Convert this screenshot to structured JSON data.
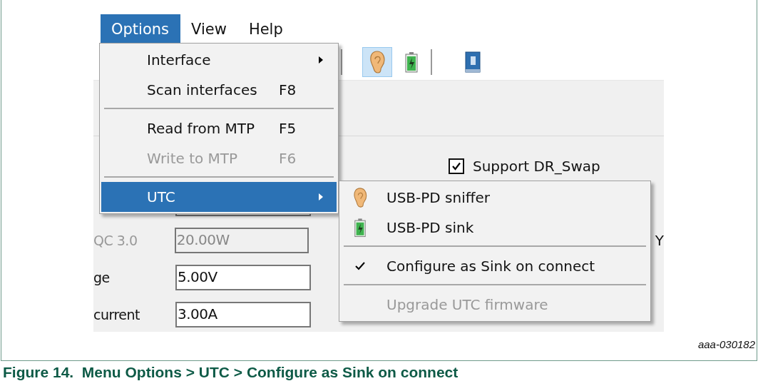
{
  "menu_bar": [
    {
      "label": "Options",
      "selected": true
    },
    {
      "label": "View",
      "selected": false
    },
    {
      "label": "Help",
      "selected": false
    }
  ],
  "toolbar": [
    {
      "kind": "separator"
    },
    {
      "kind": "sniffer",
      "selected": true
    },
    {
      "kind": "sink",
      "selected": false
    },
    {
      "kind": "separator"
    },
    {
      "kind": "help",
      "selected": false
    }
  ],
  "form": {
    "checkbox": {
      "label": "Support DR_Swap",
      "checked": true
    },
    "rows": [
      {
        "label": "",
        "value": ""
      },
      {
        "label": "QC 3.0",
        "value": "20.00W",
        "disabled": true
      },
      {
        "label": "ge",
        "value": "5.00V",
        "disabled": false
      },
      {
        "label": "current",
        "value": "3.00A",
        "disabled": false
      }
    ],
    "side_text": "Y"
  },
  "options_menu": [
    {
      "kind": "item",
      "label": "Interface",
      "submenu": true,
      "disabled": false,
      "selected": false
    },
    {
      "kind": "item",
      "label": "Scan interfaces",
      "shortcut": "F8",
      "submenu": false,
      "disabled": false,
      "selected": false
    },
    {
      "kind": "separator"
    },
    {
      "kind": "item",
      "label": "Read from MTP",
      "shortcut": "F5",
      "submenu": false,
      "disabled": false,
      "selected": false
    },
    {
      "kind": "item",
      "label": "Write to MTP",
      "shortcut": "F6",
      "submenu": false,
      "disabled": true,
      "selected": false
    },
    {
      "kind": "separator"
    },
    {
      "kind": "item",
      "label": "UTC",
      "submenu": true,
      "disabled": false,
      "selected": true
    }
  ],
  "utc_submenu": [
    {
      "kind": "sniffer",
      "label": "USB-PD sniffer",
      "checked": false,
      "disabled": false
    },
    {
      "kind": "sink",
      "label": "USB-PD sink",
      "checked": false,
      "disabled": false
    },
    {
      "kind": "separator"
    },
    {
      "kind": "plain",
      "label": "Configure as Sink on connect",
      "checked": true,
      "disabled": false
    },
    {
      "kind": "separator"
    },
    {
      "kind": "plain",
      "label": "Upgrade UTC firmware",
      "checked": false,
      "disabled": true
    }
  ],
  "figure_id": "aaa-030182",
  "caption": "Figure 14.  Menu Options > UTC > Configure as Sink on connect"
}
